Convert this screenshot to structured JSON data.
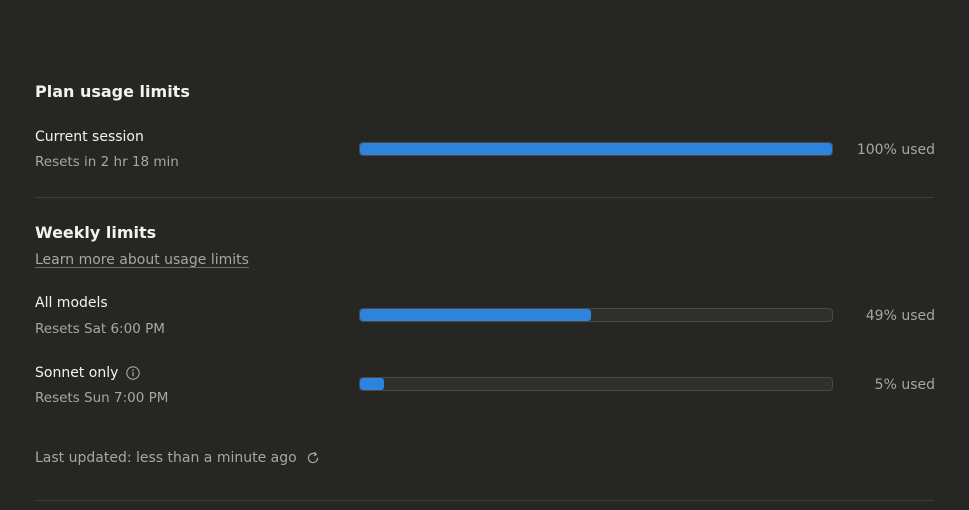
{
  "plan": {
    "title": "Plan usage limits",
    "current_session": {
      "label": "Current session",
      "reset": "Resets in 2 hr 18 min",
      "percent_used": 100,
      "percent_label": "100% used"
    }
  },
  "weekly": {
    "title": "Weekly limits",
    "learn_more": "Learn more about usage limits",
    "all_models": {
      "label": "All models",
      "reset": "Resets Sat 6:00 PM",
      "percent_used": 49,
      "percent_label": "49% used"
    },
    "sonnet_only": {
      "label": "Sonnet only",
      "reset": "Resets Sun 7:00 PM",
      "percent_used": 5,
      "percent_label": "5% used",
      "icon": "info-icon"
    }
  },
  "footer": {
    "last_updated": "Last updated: less than a minute ago",
    "icon": "refresh-icon"
  },
  "colors": {
    "background": "#262624",
    "bar_fill": "#2e83dc",
    "bar_track": "#2f2f2c",
    "text_primary": "#f3f2ee",
    "text_secondary": "#a8a69f"
  }
}
